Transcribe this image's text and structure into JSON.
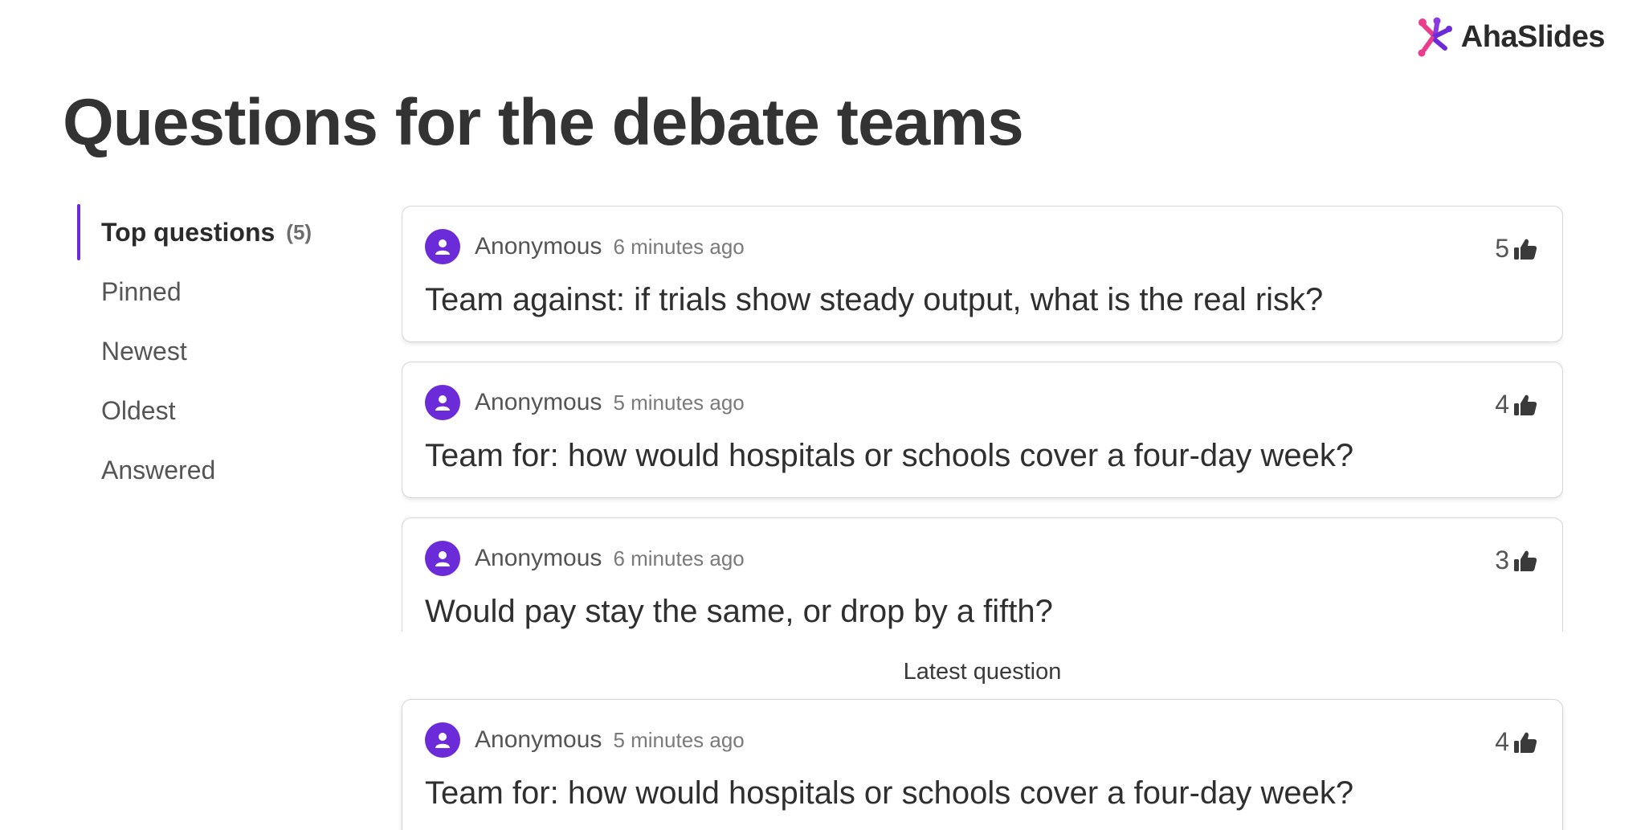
{
  "brand": {
    "logo_text": "AhaSlides",
    "colors": {
      "accent": "#6c2bd9",
      "logo_pink": "#e83e8c",
      "logo_purple": "#6c2bd9"
    }
  },
  "page": {
    "title": "Questions for the debate teams"
  },
  "sidebar": {
    "items": [
      {
        "label": "Top questions",
        "count": "(5)",
        "active": true
      },
      {
        "label": "Pinned"
      },
      {
        "label": "Newest"
      },
      {
        "label": "Oldest"
      },
      {
        "label": "Answered"
      }
    ]
  },
  "questions": [
    {
      "author": "Anonymous",
      "time": "6 minutes ago",
      "votes": "5",
      "text": "Team against: if trials show steady output, what is the real risk?",
      "avatar_icon": "user-icon",
      "vote_icon": "thumbs-up-icon"
    },
    {
      "author": "Anonymous",
      "time": "5 minutes ago",
      "votes": "4",
      "text": "Team for: how would hospitals or schools cover a four-day week?",
      "avatar_icon": "user-icon",
      "vote_icon": "thumbs-up-icon"
    },
    {
      "author": "Anonymous",
      "time": "6 minutes ago",
      "votes": "3",
      "text": "Would pay stay the same, or drop by a fifth?",
      "avatar_icon": "user-icon",
      "vote_icon": "thumbs-up-icon"
    }
  ],
  "latest": {
    "label": "Latest question",
    "question": {
      "author": "Anonymous",
      "time": "5 minutes ago",
      "votes": "4",
      "text": "Team for: how would hospitals or schools cover a four-day week?",
      "avatar_icon": "user-icon",
      "vote_icon": "thumbs-up-icon"
    }
  }
}
